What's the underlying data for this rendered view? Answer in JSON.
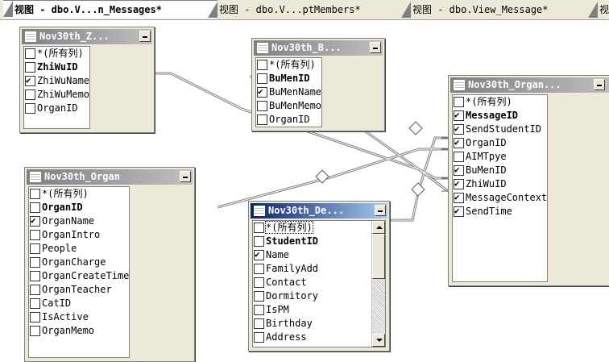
{
  "tabs": [
    {
      "label": "视图 - dbo.V...n_Messages*",
      "active": true
    },
    {
      "label": "视图 - dbo.V...ptMembers*",
      "active": false
    },
    {
      "label": "视图 - dbo.View_Message*",
      "active": false
    },
    {
      "label": "视图",
      "active": false
    }
  ],
  "tables": {
    "zhiwu": {
      "title": "Nov30th_Z...",
      "columns": [
        {
          "name": "*(所有列)",
          "checked": false
        },
        {
          "name": "ZhiWuID",
          "checked": false,
          "pk": true
        },
        {
          "name": "ZhiWuName",
          "checked": true
        },
        {
          "name": "ZhiWuMemo",
          "checked": false
        },
        {
          "name": "OrganID",
          "checked": false
        }
      ]
    },
    "bumen": {
      "title": "Nov30th_B...",
      "columns": [
        {
          "name": "*(所有列)",
          "checked": false
        },
        {
          "name": "BuMenID",
          "checked": false,
          "pk": true
        },
        {
          "name": "BuMenName",
          "checked": true
        },
        {
          "name": "BuMenMemo",
          "checked": false
        },
        {
          "name": "OrganID",
          "checked": false
        }
      ]
    },
    "messages": {
      "title": "Nov30th_Organ...",
      "columns": [
        {
          "name": "*(所有列)",
          "checked": false
        },
        {
          "name": "MessageID",
          "checked": true,
          "pk": true
        },
        {
          "name": "SendStudentID",
          "checked": true
        },
        {
          "name": "OrganID",
          "checked": true
        },
        {
          "name": "AIMTpye",
          "checked": false
        },
        {
          "name": "BuMenID",
          "checked": true
        },
        {
          "name": "ZhiWuID",
          "checked": true
        },
        {
          "name": "MessageContext",
          "checked": true
        },
        {
          "name": "SendTime",
          "checked": true
        }
      ]
    },
    "organ": {
      "title": "Nov30th_Organ",
      "columns": [
        {
          "name": "*(所有列)",
          "checked": false
        },
        {
          "name": "OrganID",
          "checked": false,
          "pk": true
        },
        {
          "name": "OrganName",
          "checked": true
        },
        {
          "name": "OrganIntro",
          "checked": false
        },
        {
          "name": "People",
          "checked": false
        },
        {
          "name": "OrganCharge",
          "checked": false
        },
        {
          "name": "OrganCreateTime",
          "checked": false
        },
        {
          "name": "OrganTeacher",
          "checked": false
        },
        {
          "name": "CatID",
          "checked": false
        },
        {
          "name": "IsActive",
          "checked": false
        },
        {
          "name": "OrganMemo",
          "checked": false
        }
      ]
    },
    "dept": {
      "title": "Nov30th_De...",
      "columns": [
        {
          "name": "*(所有列)",
          "checked": false,
          "focus": true
        },
        {
          "name": "StudentID",
          "checked": false,
          "pk": true
        },
        {
          "name": "Name",
          "checked": true
        },
        {
          "name": "FamilyAdd",
          "checked": false
        },
        {
          "name": "Contact",
          "checked": false
        },
        {
          "name": "Dormitory",
          "checked": false
        },
        {
          "name": "IsPM",
          "checked": false
        },
        {
          "name": "Birthday",
          "checked": false
        },
        {
          "name": "Address",
          "checked": false
        }
      ]
    }
  },
  "colors": {
    "active_title": "#0a246a",
    "inactive_title": "#808080",
    "chrome": "#ece9d8"
  }
}
